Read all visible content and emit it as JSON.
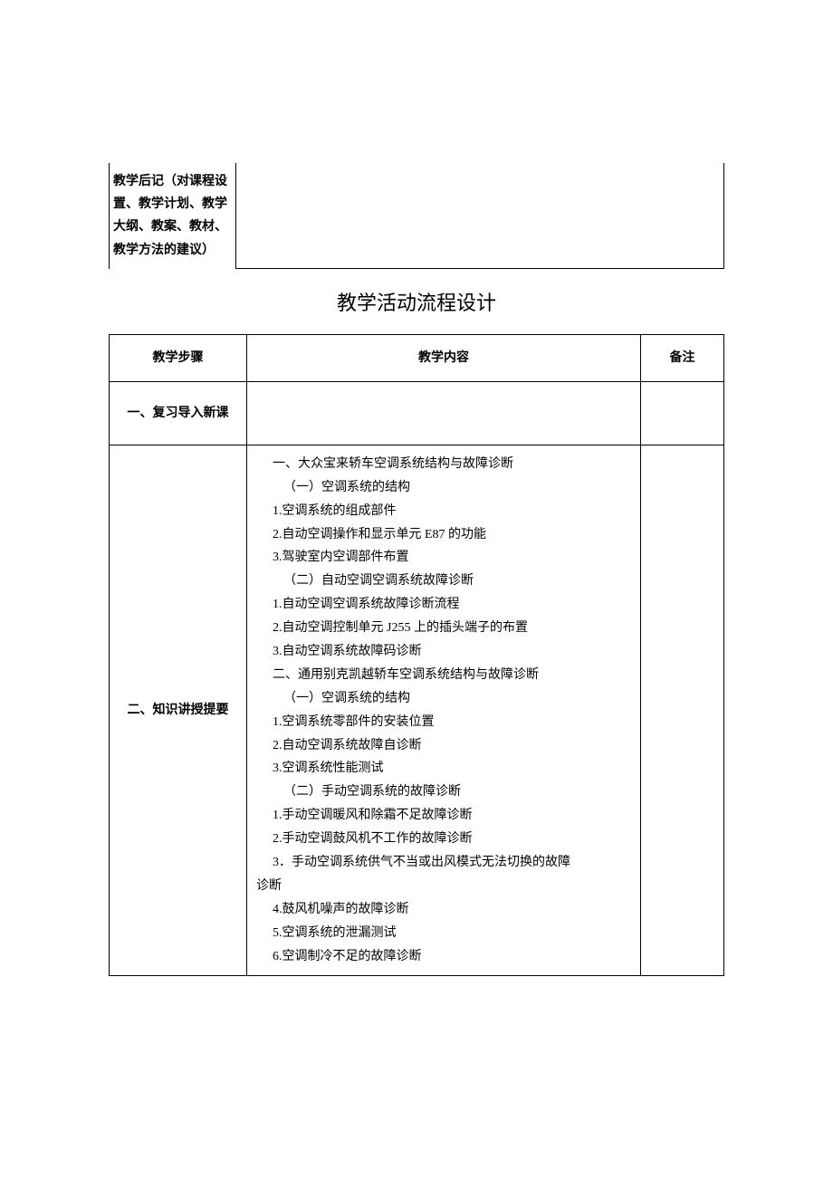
{
  "top": {
    "label": "教学后记（对课程设置、教学计划、教学大纲、教案、教材、教学方法的建议）",
    "content": ""
  },
  "section_title": "教学活动流程设计",
  "headers": {
    "step": "教学步骤",
    "content": "教学内容",
    "note": "备注"
  },
  "rows": {
    "r1": {
      "step": "一、复习导入新课",
      "content": "",
      "note": ""
    },
    "r2": {
      "step": "二、知识讲授提要",
      "lines": {
        "l1": "一、大众宝来轿车空调系统结构与故障诊断",
        "l2": "（一）空调系统的结构",
        "l3": "1.空调系统的组成部件",
        "l4": "2.自动空调操作和显示单元 E87 的功能",
        "l5": "3.驾驶室内空调部件布置",
        "l6": "（二）自动空调空调系统故障诊断",
        "l7": "1.自动空调空调系统故障诊断流程",
        "l8": "2.自动空调控制单元 J255 上的插头端子的布置",
        "l9": "3.自动空调系统故障码诊断",
        "l10": "二、通用别克凯越轿车空调系统结构与故障诊断",
        "l11": "（一）空调系统的结构",
        "l12": "1.空调系统零部件的安装位置",
        "l13": "2.自动空调系统故障自诊断",
        "l14": "3.空调系统性能测试",
        "l15": "（二）手动空调系统的故障诊断",
        "l16": "1.手动空调暖风和除霜不足故障诊断",
        "l17": "2.手动空调鼓风机不工作的故障诊断",
        "l18a": "3．手动空调系统供气不当或出风模式无法切换的故障",
        "l18b": "诊断",
        "l19": "4.鼓风机噪声的故障诊断",
        "l20": "5.空调系统的泄漏测试",
        "l21": "6.空调制冷不足的故障诊断"
      },
      "note": ""
    }
  }
}
